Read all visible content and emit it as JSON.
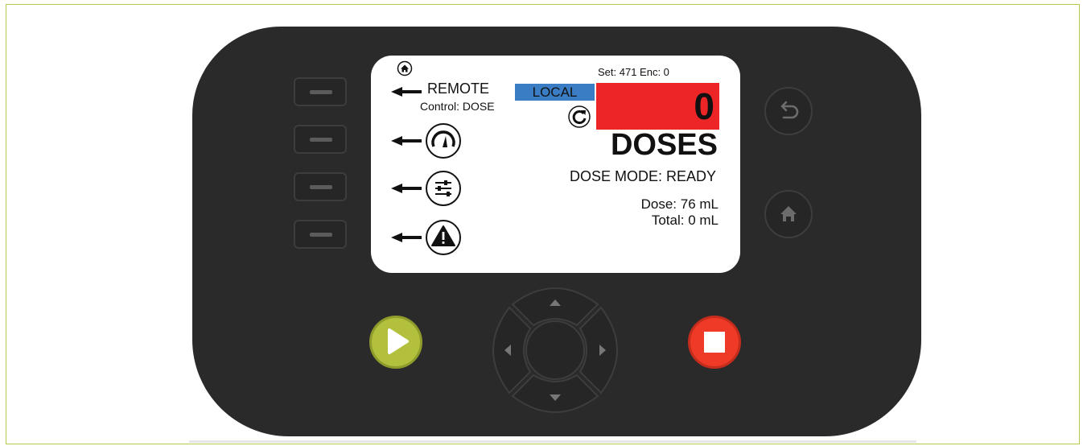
{
  "screen": {
    "remote_label": "REMOTE",
    "control_text": "Control: DOSE",
    "set_enc_text": "Set: 471  Enc: 0",
    "local_label": "LOCAL",
    "count_value": "0",
    "unit_label": "DOSES",
    "mode_text": "DOSE MODE: READY",
    "dose_text": "Dose: 76 mL",
    "total_text": "Total: 0 mL",
    "menu_icons": [
      "home-icon",
      "gauge-icon",
      "settings-sliders-icon",
      "warning-icon"
    ],
    "count_bg_color": "#ee2526",
    "local_bg_color": "#3b7dc5"
  },
  "device": {
    "left_buttons": [
      "softkey-1",
      "softkey-2",
      "softkey-3",
      "softkey-4"
    ],
    "right_buttons": [
      "back-icon",
      "home-icon"
    ],
    "start_color": "#b2c03d",
    "stop_color": "#ee3a27",
    "dpad": [
      "up",
      "down",
      "left",
      "right",
      "center"
    ]
  }
}
